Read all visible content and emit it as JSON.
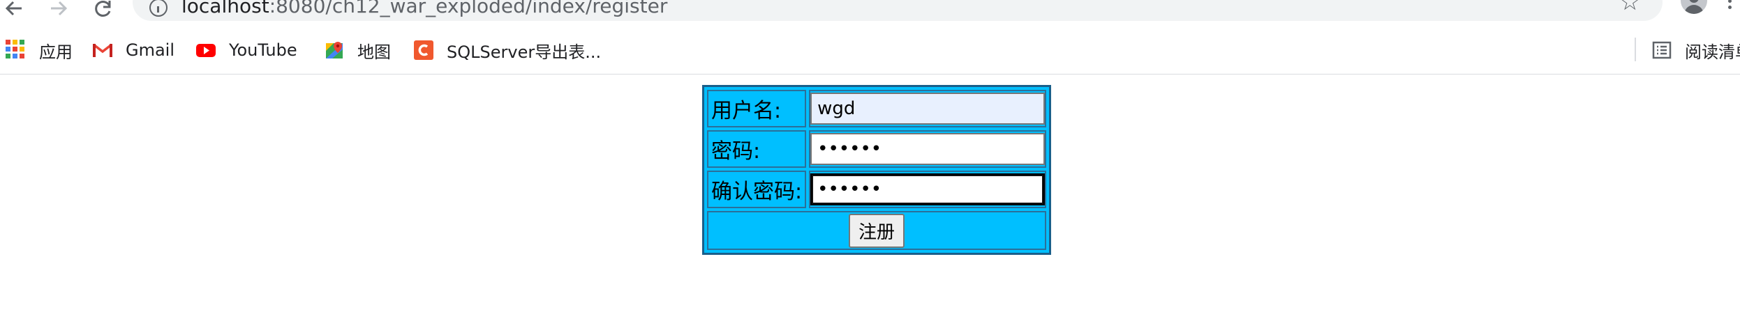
{
  "browser": {
    "url_host": "localhost",
    "url_path": ":8080/ch12_war_exploded/index/register",
    "back_icon": "back-arrow-icon",
    "forward_icon": "forward-arrow-icon",
    "reload_icon": "reload-icon"
  },
  "bookmarks": {
    "items": [
      {
        "label": "应用",
        "icon": "apps-grid-icon"
      },
      {
        "label": "Gmail",
        "icon": "gmail-icon"
      },
      {
        "label": "YouTube",
        "icon": "youtube-icon"
      },
      {
        "label": "地图",
        "icon": "maps-icon"
      },
      {
        "label": "SQLServer导出表...",
        "icon": "bookmark-c-icon"
      }
    ],
    "reading_list": {
      "label": "阅读清单",
      "icon": "reading-list-icon"
    }
  },
  "form": {
    "username_label": "用户名:",
    "username_value": "wgd",
    "password_label": "密码:",
    "password_value": "••••••",
    "confirm_label": "确认密码:",
    "confirm_value": "••••••",
    "submit_label": "注册"
  },
  "colors": {
    "table_bg": "#00bfff",
    "table_border": "#1a5f8a",
    "autofill_bg": "#e8f0fe"
  }
}
